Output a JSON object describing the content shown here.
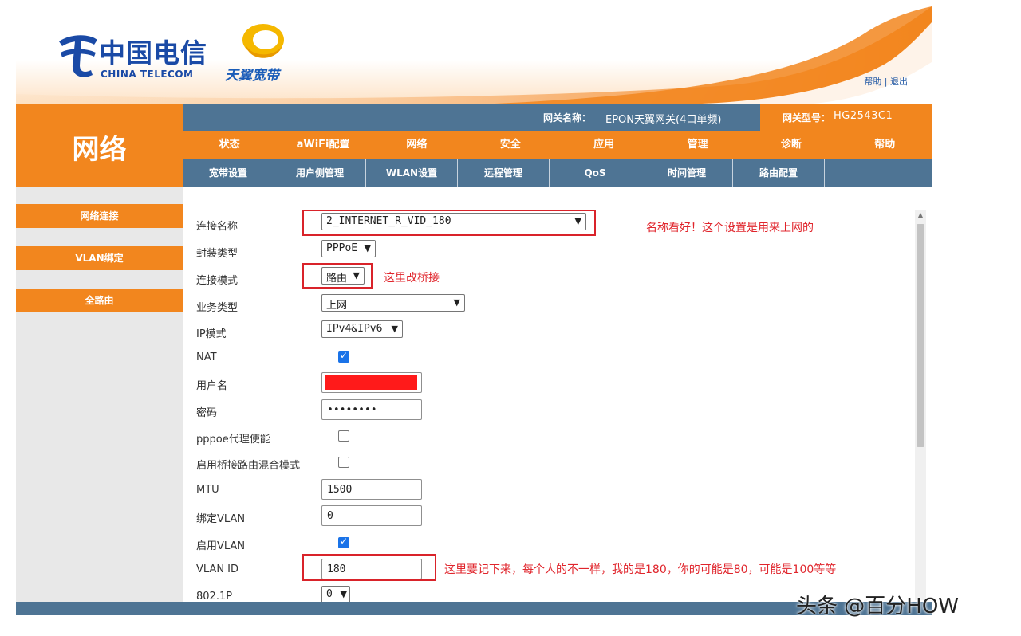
{
  "brand": {
    "telecom_cn": "中国电信",
    "telecom_en": "CHINA TELECOM",
    "tianyi": "天翼宽带",
    "header_links": "帮助 | 退出"
  },
  "section_title": "网络",
  "info_bar": {
    "gateway_name_label": "网关名称：",
    "gateway_name_value": "EPON天翼网关(4口单频)",
    "gateway_model_label": "网关型号：",
    "gateway_model_value": "HG2543C1"
  },
  "main_nav": [
    "状态",
    "aWiFi配置",
    "网络",
    "安全",
    "应用",
    "管理",
    "诊断",
    "帮助"
  ],
  "sub_nav": [
    "宽带设置",
    "用户侧管理",
    "WLAN设置",
    "远程管理",
    "QoS",
    "时间管理",
    "路由配置"
  ],
  "sidebar": [
    "网络连接",
    "VLAN绑定",
    "全路由"
  ],
  "form": {
    "connection_name": {
      "label": "连接名称",
      "value": "2_INTERNET_R_VID_180"
    },
    "encap_type": {
      "label": "封装类型",
      "value": "PPPoE"
    },
    "connection_mode": {
      "label": "连接模式",
      "value": "路由"
    },
    "service_type": {
      "label": "业务类型",
      "value": "上网"
    },
    "ip_mode": {
      "label": "IP模式",
      "value": "IPv4&IPv6"
    },
    "nat": {
      "label": "NAT",
      "checked": true
    },
    "username": {
      "label": "用户名",
      "value": ""
    },
    "password": {
      "label": "密码",
      "value": "••••••••"
    },
    "pppoe_proxy": {
      "label": "pppoe代理使能",
      "checked": false
    },
    "bridge_mixed": {
      "label": "启用桥接路由混合模式",
      "checked": false
    },
    "mtu": {
      "label": "MTU",
      "value": "1500"
    },
    "bind_vlan": {
      "label": "绑定VLAN",
      "value": "0"
    },
    "enable_vlan": {
      "label": "启用VLAN",
      "checked": true
    },
    "vlan_id": {
      "label": "VLAN ID",
      "value": "180"
    },
    "dot1p": {
      "label": "802.1P",
      "value": "0"
    }
  },
  "annotations": {
    "name_note": "名称看好！这个设置是用来上网的",
    "mode_note": "这里改桥接",
    "vlan_note": "这里要记下来，每个人的不一样，我的是180，你的可能是80，可能是100等等"
  },
  "watermark": "头条 @百分HOW",
  "colors": {
    "orange": "#f2861e",
    "steel_blue": "#4e7494",
    "annotation_red": "#d9232a",
    "brand_blue": "#1a4aa6"
  }
}
